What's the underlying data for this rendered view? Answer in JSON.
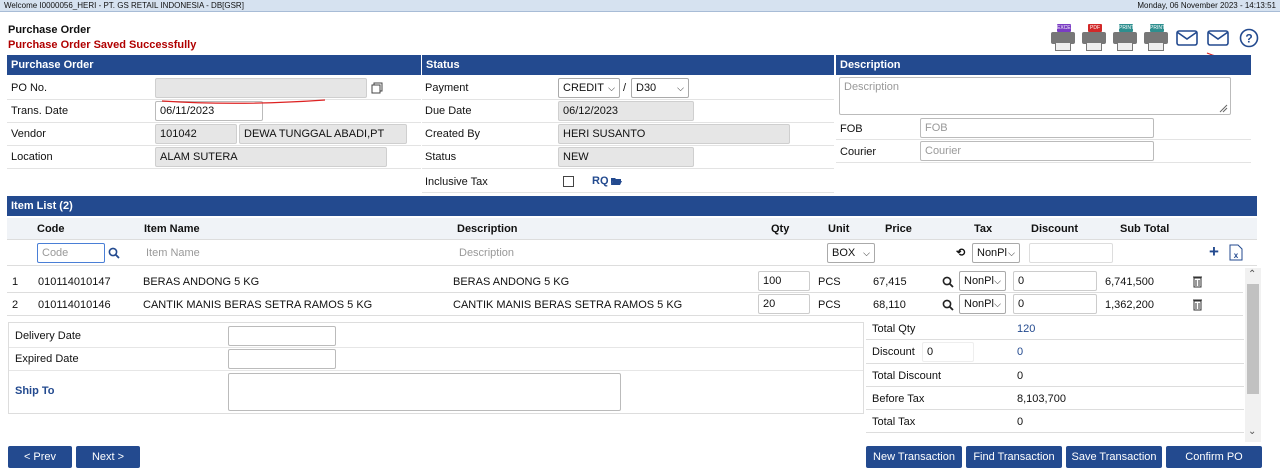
{
  "topbar": {
    "welcome": "Welcome I0000056_HERI - PT. GS RETAIL INDONESIA - DB[GSR]",
    "datetime": "Monday, 06 November 2023 - 14:13:51"
  },
  "page": {
    "title": "Purchase Order",
    "message": "Purchase Order Saved Successfully"
  },
  "toolbar": {
    "printers": [
      {
        "label": "EXCEL",
        "color": "#7a3cc4"
      },
      {
        "label": "PDF",
        "color": "#d22828"
      },
      {
        "label": "PRINT1",
        "color": "#2e8f8f"
      },
      {
        "label": "PRINT2",
        "color": "#2e8f8f"
      }
    ]
  },
  "po_panel": {
    "header": "Purchase Order",
    "po_no_label": "PO No.",
    "po_no_value": "",
    "trans_date_label": "Trans. Date",
    "trans_date_value": "06/11/2023",
    "vendor_label": "Vendor",
    "vendor_code": "101042",
    "vendor_name": "DEWA TUNGGAL ABADI,PT",
    "location_label": "Location",
    "location_value": "ALAM SUTERA"
  },
  "status_panel": {
    "header": "Status",
    "payment_label": "Payment",
    "payment_type": "CREDIT",
    "payment_term": "D30",
    "due_date_label": "Due Date",
    "due_date_value": "06/12/2023",
    "created_by_label": "Created By",
    "created_by_value": "HERI SUSANTO",
    "status_label": "Status",
    "status_value": "NEW",
    "inclusive_tax_label": "Inclusive Tax",
    "rq_label": "RQ"
  },
  "desc_panel": {
    "header": "Description",
    "description_placeholder": "Description",
    "fob_label": "FOB",
    "fob_placeholder": "FOB",
    "courier_label": "Courier",
    "courier_placeholder": "Courier"
  },
  "item_list": {
    "header": "Item List (2)",
    "columns": {
      "code": "Code",
      "item_name": "Item Name",
      "description": "Description",
      "qty": "Qty",
      "unit": "Unit",
      "price": "Price",
      "tax": "Tax",
      "discount": "Discount",
      "sub_total": "Sub Total"
    },
    "entry": {
      "code_placeholder": "Code",
      "item_name_placeholder": "Item Name",
      "description_placeholder": "Description",
      "unit": "BOX",
      "tax": "NonPl"
    },
    "rows": [
      {
        "no": "1",
        "code": "010114010147",
        "item_name": "BERAS ANDONG 5 KG",
        "description": "BERAS ANDONG 5 KG",
        "qty": "100",
        "unit": "PCS",
        "price": "67,415",
        "tax": "NonPl",
        "discount": "0",
        "sub_total": "6,741,500"
      },
      {
        "no": "2",
        "code": "010114010146",
        "item_name": "CANTIK MANIS BERAS SETRA RAMOS 5 KG",
        "description": "CANTIK MANIS BERAS SETRA RAMOS 5 KG",
        "qty": "20",
        "unit": "PCS",
        "price": "68,110",
        "tax": "NonPl",
        "discount": "0",
        "sub_total": "1,362,200"
      }
    ]
  },
  "footer_left": {
    "delivery_date_label": "Delivery Date",
    "expired_date_label": "Expired Date",
    "ship_to_label": "Ship To"
  },
  "totals": {
    "total_qty_label": "Total Qty",
    "total_qty_value": "120",
    "discount_label": "Discount",
    "discount_input": "0",
    "discount_value": "0",
    "total_discount_label": "Total Discount",
    "total_discount_value": "0",
    "before_tax_label": "Before Tax",
    "before_tax_value": "8,103,700",
    "total_tax_label": "Total Tax",
    "total_tax_value": "0"
  },
  "buttons": {
    "prev": "< Prev",
    "next": "Next >",
    "new_transaction": "New Transaction",
    "find_transaction": "Find Transaction",
    "save_transaction": "Save Transaction",
    "confirm_po": "Confirm PO"
  }
}
